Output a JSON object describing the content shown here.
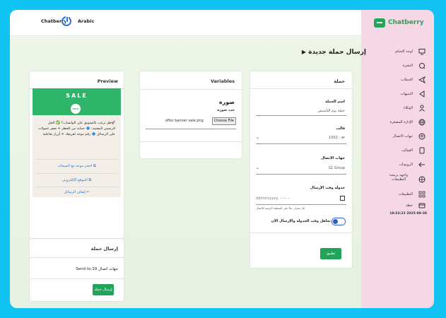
{
  "topbar": {
    "brand": "Chatberry",
    "language": "Arabic"
  },
  "sidebar": {
    "logo": "Chatberry",
    "items": [
      {
        "label": "لوحة التحكم",
        "icon": "monitor-icon"
      },
      {
        "label": "النشرة",
        "icon": "search-icon"
      },
      {
        "label": "الحملات",
        "icon": "send-icon"
      },
      {
        "label": "التنبيهات",
        "icon": "triangle-left-icon"
      },
      {
        "label": "الوكلاء",
        "icon": "user-icon"
      },
      {
        "label": "الإدارة المصغرة",
        "icon": "globe-icon"
      },
      {
        "label": "جهات الاتصال",
        "icon": "contact-icon"
      },
      {
        "label": "القوالب",
        "icon": "template-icon"
      },
      {
        "label": "الروبوتات",
        "icon": "arrow-left-icon"
      },
      {
        "label": "واجهة برمجة التطبيقات",
        "icon": "api-globe-icon"
      },
      {
        "label": "التطبيقات",
        "icon": "apps-icon"
      },
      {
        "label": "خطة",
        "icon": "card-icon"
      }
    ],
    "timestamp": "18:33:23 2025-09-30"
  },
  "page": {
    "title": "إرسال حملة جديدة"
  },
  "campaign_form": {
    "title": "حملة",
    "name_label": "اسم الحملة",
    "name_placeholder": "حملة يوم التأسيس",
    "template_label": "قالب",
    "template_value": "1002 - ar",
    "contacts_label": "جهات الاتصال",
    "contacts_value": "S1 Group",
    "schedule_label": "جدولة وقت الإرسال",
    "schedule_placeholder": "dd/mm/yyyy, --:-- --",
    "schedule_hint": "اتل تعديل، بناءً على المنطقة الزمنية للاتصال",
    "toggle_label": "تجاهل وقت الجدولة والإرسال الآن",
    "submit_label": "تطبيق"
  },
  "variables": {
    "title": "Variables",
    "image_heading": "صورة",
    "image_sub": "حدد صورة",
    "file_name": "offer banner sale.png",
    "choose_file": "Choose File"
  },
  "preview": {
    "title": "Preview",
    "banner_text": "SALE",
    "badge": "SALE",
    "message": "🚀هل ترغب بالتسويق على الواتساب؟ ✅ الحل الرسمي المعتمد: 🔷 حماية من الحظر + صفر عمولات على الرسائل 🔷 رقم موحد لفريقك + أزرار تفاعلية",
    "link1": "احجز موعد مع المبيعات",
    "link2": "الموقع الإلكتروني",
    "link3": "إيقاف الرسائل"
  },
  "send_card": {
    "title": "إرسال حملة",
    "send_to": "Send to:19 جهات اتصال",
    "button": "إرسال حملة"
  }
}
